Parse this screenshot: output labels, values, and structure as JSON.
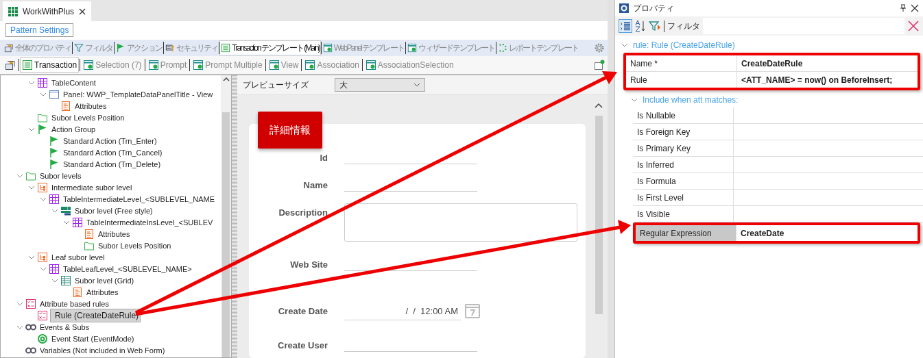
{
  "editor_tab": {
    "title": "WorkWithPlus"
  },
  "pattern_settings_button": "Pattern Settings",
  "template_tabs": [
    {
      "label": "全体のプロパティ",
      "kind": "properties",
      "selected": false
    },
    {
      "label": "フィルタ",
      "kind": "filter",
      "selected": false
    },
    {
      "label": "アクション",
      "kind": "flag",
      "selected": false
    },
    {
      "label": "セキュリティ",
      "kind": "security",
      "selected": false
    },
    {
      "label": "Transaction テンプレート (Main)",
      "kind": "transaction",
      "selected": true
    },
    {
      "label": "WebPanel テンプレート",
      "kind": "template",
      "selected": false
    },
    {
      "label": "ウィザードテンプレート",
      "kind": "template",
      "selected": false
    },
    {
      "label": "レポートテンプレート",
      "kind": "report",
      "selected": false
    }
  ],
  "object_tabs": [
    {
      "kind": "properties",
      "selected": false
    },
    {
      "label": "Transaction",
      "kind": "transaction",
      "selected": true
    },
    {
      "label": "Selection (7)",
      "kind": "template",
      "selected": false
    },
    {
      "label": "Prompt",
      "kind": "template",
      "selected": false
    },
    {
      "label": "Prompt Multiple",
      "kind": "template",
      "selected": false
    },
    {
      "label": "View",
      "kind": "template",
      "selected": false
    },
    {
      "label": "Association",
      "kind": "template",
      "selected": false
    },
    {
      "label": "AssociationSelection",
      "kind": "template",
      "selected": false
    }
  ],
  "tree": {
    "items": [
      {
        "children": [
          {
            "label": "TableContent",
            "kind": "table",
            "expanded": true,
            "selected": false,
            "children": [
              {
                "label": "Panel: WWP_TemplateDataPanelTitle - View",
                "kind": "panel",
                "expanded": true,
                "selected": false,
                "children": [
                  {
                    "label": "Attributes",
                    "kind": "attributes",
                    "selected": false
                  }
                ]
              }
            ]
          },
          {
            "label": "Subor Levels Position",
            "kind": "folder",
            "selected": false
          },
          {
            "label": "Action Group",
            "kind": "flag",
            "expanded": true,
            "selected": false,
            "children": [
              {
                "label": "Standard Action (Trn_Enter)",
                "kind": "flag",
                "selected": false
              },
              {
                "label": "Standard Action (Trn_Cancel)",
                "kind": "flag",
                "selected": false
              },
              {
                "label": "Standard Action (Trn_Delete)",
                "kind": "flag",
                "selected": false
              }
            ]
          }
        ]
      },
      {
        "label": "Subor levels",
        "kind": "folder",
        "expanded": true,
        "selected": false,
        "children": [
          {
            "label": "Intermediate subor level",
            "kind": "subor",
            "expanded": true,
            "selected": false,
            "children": [
              {
                "label": "TableIntermediateLevel_<SUBLEVEL_NAME",
                "kind": "table",
                "expanded": true,
                "selected": false,
                "children": [
                  {
                    "label": "Subor level (Free style)",
                    "kind": "freestyle",
                    "expanded": true,
                    "selected": false,
                    "children": [
                      {
                        "label": "TableIntermediateInsLevel_<SUBLEV",
                        "kind": "table",
                        "expanded": true,
                        "selected": false,
                        "children": [
                          {
                            "label": "Attributes",
                            "kind": "attributes",
                            "selected": false
                          },
                          {
                            "label": "Subor Levels Position",
                            "kind": "folder",
                            "selected": false
                          }
                        ]
                      }
                    ]
                  }
                ]
              }
            ]
          },
          {
            "label": "Leaf subor level",
            "kind": "subor",
            "expanded": true,
            "selected": false,
            "children": [
              {
                "label": "TableLeafLevel_<SUBLEVEL_NAME>",
                "kind": "table",
                "expanded": true,
                "selected": false,
                "children": [
                  {
                    "label": "Subor level (Grid)",
                    "kind": "grid",
                    "expanded": true,
                    "selected": false,
                    "children": [
                      {
                        "label": "Attributes",
                        "kind": "attributes",
                        "selected": false
                      }
                    ]
                  }
                ]
              }
            ]
          }
        ]
      },
      {
        "label": "Attribute based rules",
        "kind": "rules",
        "expanded": true,
        "selected": false,
        "children": [
          {
            "label": "Rule (CreateDateRule)",
            "kind": "rules",
            "selected": true
          }
        ]
      },
      {
        "label": "Events & Subs",
        "kind": "events",
        "expanded": true,
        "selected": false,
        "children": [
          {
            "label": "Event Start (EventMode)",
            "kind": "event",
            "selected": false
          }
        ]
      },
      {
        "label": "Variables (Not included in Web Form)",
        "kind": "events",
        "selected": false
      }
    ]
  },
  "preview": {
    "size_label": "プレビューサイズ",
    "size_value": "大",
    "section_title": "詳細情報",
    "fields": [
      {
        "label": "Id",
        "kind": "text"
      },
      {
        "label": "Name",
        "kind": "text"
      },
      {
        "label": "Description",
        "kind": "textarea"
      },
      {
        "label": "Web Site",
        "kind": "text"
      },
      {
        "label": "Create Date",
        "kind": "datetime",
        "value": "/  /  12:00 AM"
      },
      {
        "label": "Create User",
        "kind": "text"
      }
    ]
  },
  "properties": {
    "title": "プロパティ",
    "filter_label": "フィルタ",
    "category": {
      "label": "rule: Rule (CreateDateRule)",
      "expanded": true,
      "rows": [
        {
          "name": "Name *",
          "value": "CreateDateRule",
          "annotated": true,
          "selected": false
        },
        {
          "name": "Rule",
          "value": "<ATT_NAME> = now() on BeforeInsert;",
          "annotated": true,
          "selected": false
        }
      ],
      "subcategory": {
        "label": "Include when att matches:",
        "expanded": true,
        "rows": [
          {
            "name": "Is Nullable",
            "annotated": false,
            "selected": false
          },
          {
            "name": "Is Foreign Key",
            "annotated": false,
            "selected": false
          },
          {
            "name": "Is Primary Key",
            "annotated": false,
            "selected": false
          },
          {
            "name": "Is Inferred",
            "annotated": false,
            "selected": false
          },
          {
            "name": "Is Formula",
            "annotated": false,
            "selected": false
          },
          {
            "name": "Is First Level",
            "annotated": false,
            "selected": false
          },
          {
            "name": "Is Visible",
            "annotated": false,
            "selected": false
          },
          {
            "name": "Regular Expression",
            "value": "CreateDate",
            "annotated": true,
            "selected": true
          }
        ]
      }
    }
  }
}
